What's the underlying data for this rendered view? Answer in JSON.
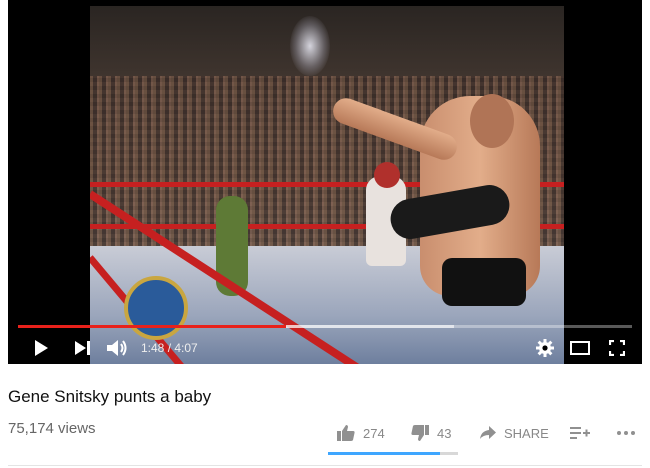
{
  "player": {
    "time_display": "1:48 / 4:07",
    "progress_fraction": 0.437,
    "buffer_fraction": 0.71,
    "accent_color": "#e8211b",
    "icons": {
      "play": "play-icon",
      "next": "next-icon",
      "volume": "volume-icon",
      "settings": "gear-icon",
      "theater": "theater-mode-icon",
      "fullscreen": "fullscreen-icon"
    }
  },
  "video": {
    "title": "Gene Snitsky punts a baby",
    "views": "75,174 views"
  },
  "actions": {
    "like_count": "274",
    "dislike_count": "43",
    "share_label": "SHARE",
    "like_fraction": 0.864,
    "icons": {
      "like": "thumbs-up-icon",
      "dislike": "thumbs-down-icon",
      "share": "share-arrow-icon",
      "save": "add-to-playlist-icon",
      "more": "more-options-icon"
    }
  }
}
